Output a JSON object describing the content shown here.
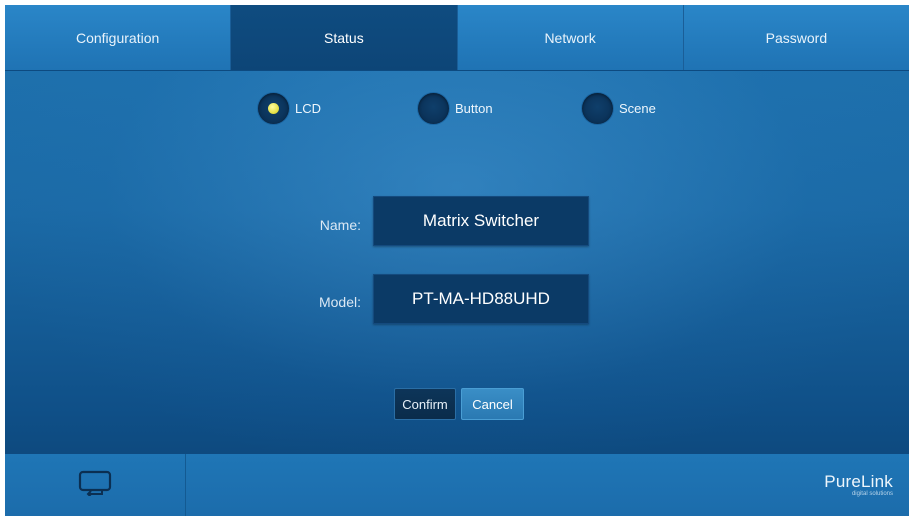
{
  "tabs": [
    {
      "label": "Configuration",
      "active": false
    },
    {
      "label": "Status",
      "active": true
    },
    {
      "label": "Network",
      "active": false
    },
    {
      "label": "Password",
      "active": false
    }
  ],
  "radios": {
    "lcd": {
      "label": "LCD",
      "selected": true
    },
    "button": {
      "label": "Button",
      "selected": false
    },
    "scene": {
      "label": "Scene",
      "selected": false
    }
  },
  "form": {
    "name_label": "Name:",
    "name_value": "Matrix Switcher",
    "model_label": "Model:",
    "model_value": "PT-MA-HD88UHD"
  },
  "actions": {
    "confirm": "Confirm",
    "cancel": "Cancel"
  },
  "footer": {
    "back_icon": "screen-return-icon",
    "brand": "PureLink",
    "tagline": "digital solutions"
  },
  "colors": {
    "accent_yellow": "#e6e24a",
    "active_tab": "#0f4c80",
    "background": "#1b6aa6"
  }
}
